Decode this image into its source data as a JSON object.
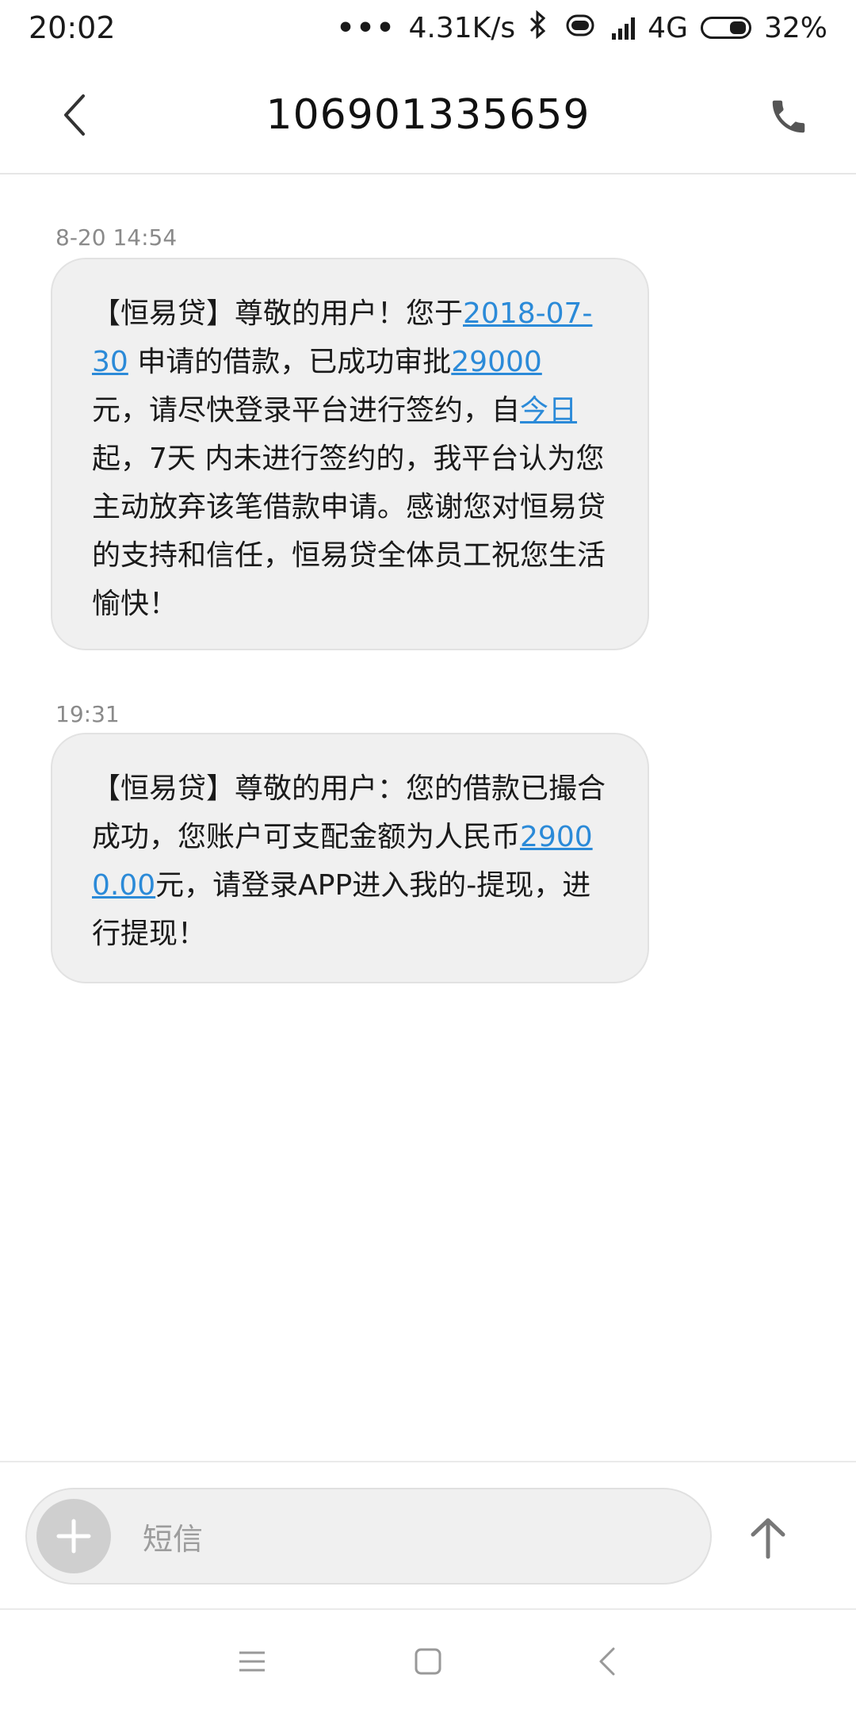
{
  "status_bar": {
    "time": "20:02",
    "dots": "•••",
    "speed": "4.31K/s",
    "network": "4G",
    "battery": "32%"
  },
  "header": {
    "title": "106901335659"
  },
  "messages": [
    {
      "timestamp": "8-20 14:54",
      "parts": [
        {
          "text": "【恒易贷】尊敬的用户！您于",
          "link": false
        },
        {
          "text": "2018-07-30",
          "link": true
        },
        {
          "text": " 申请的借款，已成功审批",
          "link": false
        },
        {
          "text": "29000",
          "link": true
        },
        {
          "text": " 元，请尽快登录平台进行签约，自",
          "link": false
        },
        {
          "text": "今日",
          "link": true
        },
        {
          "text": "起，7天 内未进行签约的，我平台认为您主动放弃该笔借款申请。感谢您对恒易贷的支持和信任，恒易贷全体员工祝您生活愉快！",
          "link": false
        }
      ]
    },
    {
      "timestamp": "19:31",
      "parts": [
        {
          "text": "【恒易贷】尊敬的用户：您的借款已撮合成功，您账户可支配金额为人民币",
          "link": false
        },
        {
          "text": "29000.00",
          "link": true
        },
        {
          "text": "元，请登录APP进入我的-提现，进行提现！",
          "link": false
        }
      ]
    }
  ],
  "composer": {
    "placeholder": "短信"
  },
  "icons": {
    "back": "back-arrow-icon",
    "phone": "phone-icon",
    "add": "plus-icon",
    "send": "up-arrow-icon",
    "menu": "menu-icon",
    "home": "home-icon",
    "nav_back": "chevron-left-icon"
  },
  "colors": {
    "link": "#2b8ad8",
    "bubble": "#f0f0f0",
    "timestamp": "#8a8a8a"
  }
}
